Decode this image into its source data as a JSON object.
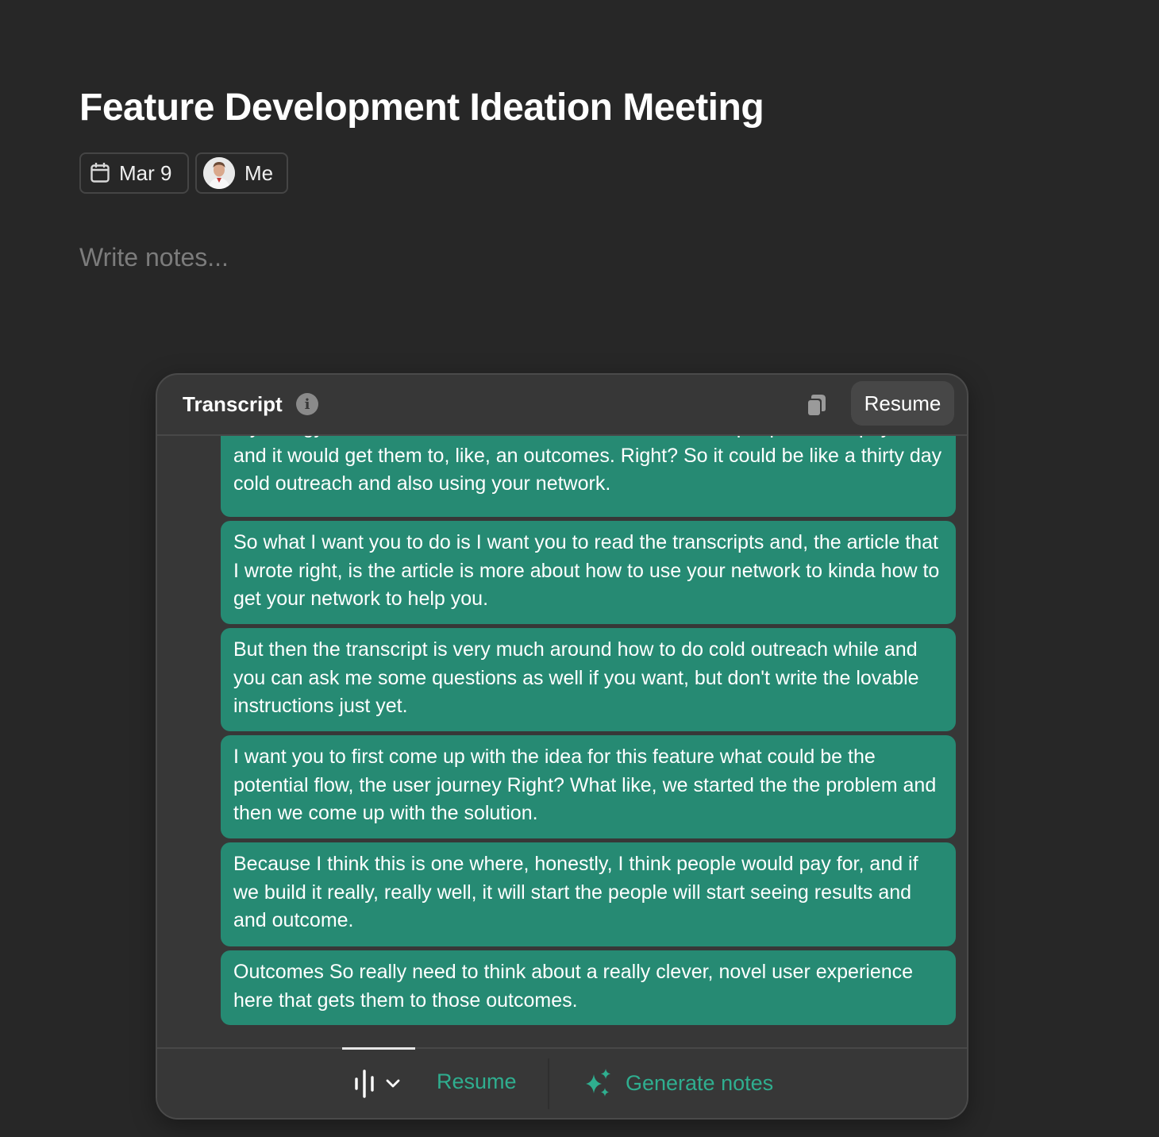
{
  "meeting": {
    "title": "Feature Development Ideation Meeting",
    "date_chip": "Mar 9",
    "participant_chip": "Me",
    "notes_placeholder": "Write notes..."
  },
  "transcript": {
    "header_title": "Transcript",
    "resume_top_label": "Resume",
    "segments": [
      "mythology of how to do because this is one where I think people would pay for and it would get them to, like, an outcomes. Right? So it could be like a thirty day cold outreach and also using your network.",
      "So what I want you to do is I want you to read the transcripts and, the article that I wrote right, is the article is more about how to use your network to kinda how to get your network to help you.",
      "But then the transcript is very much around how to do cold outreach while and you can ask me some questions as well if you want, but don't write the lovable instructions just yet.",
      "I want you to first come up with the idea for this feature what could be the potential flow, the user journey Right? What like, we started the the problem and then we come up with the solution.",
      "Because I think this is one where, honestly, I think people would pay for, and if we build it really, really well, it will start the people will start seeing results and and outcome.",
      "Outcomes So really need to think about a really clever, novel user experience here that gets them to those outcomes."
    ]
  },
  "footer": {
    "resume_label": "Resume",
    "generate_notes_label": "Generate notes"
  },
  "colors": {
    "background": "#272727",
    "panel": "#373737",
    "bubble": "#268a73",
    "accent": "#2fae8f",
    "placeholder": "#7c7c7c"
  },
  "icons": {
    "date": "calendar-icon",
    "participant": "avatar",
    "info": "info-icon",
    "copy": "copy-icon",
    "audio": "waveform-icon",
    "dropdown": "chevron-down-icon",
    "generate": "sparkles-icon"
  }
}
